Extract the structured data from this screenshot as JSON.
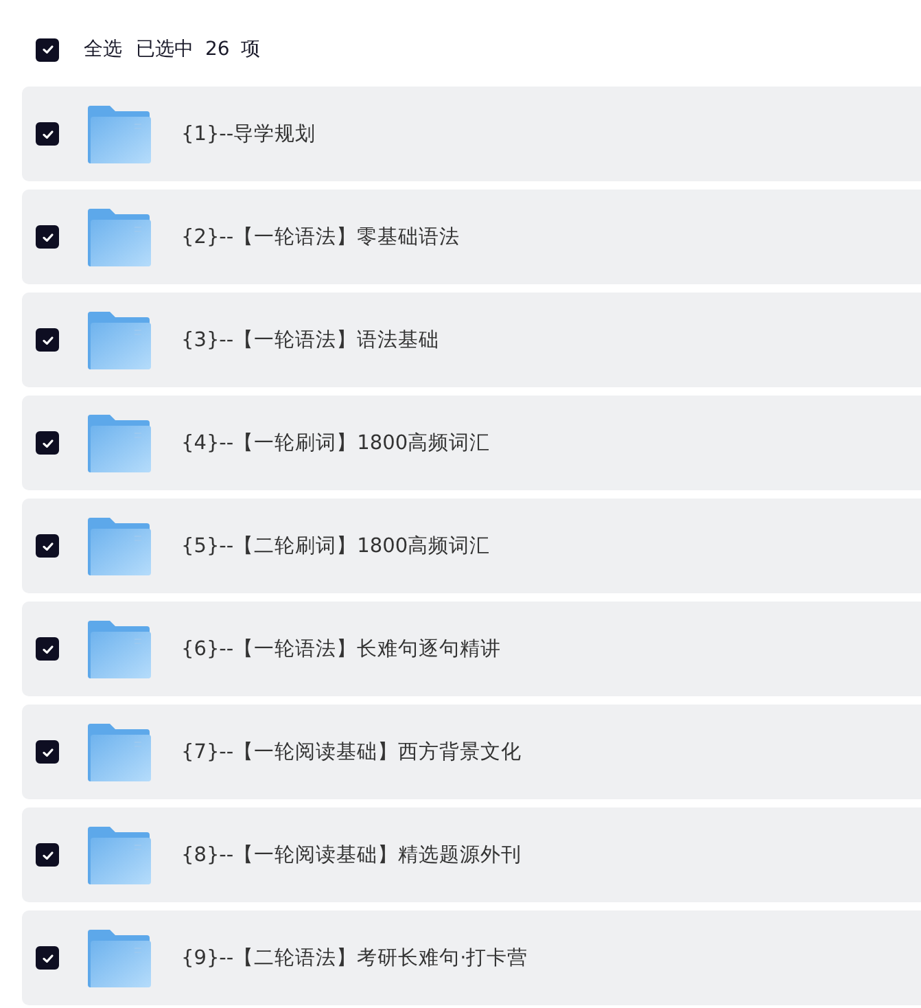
{
  "header": {
    "checked": true,
    "label": "全选",
    "status": "已选中 26 项"
  },
  "items": [
    {
      "name": "{1}--导学规划",
      "checked": true
    },
    {
      "name": "{2}--【一轮语法】零基础语法",
      "checked": true
    },
    {
      "name": "{3}--【一轮语法】语法基础",
      "checked": true
    },
    {
      "name": "{4}--【一轮刷词】1800高频词汇",
      "checked": true
    },
    {
      "name": "{5}--【二轮刷词】1800高频词汇",
      "checked": true
    },
    {
      "name": "{6}--【一轮语法】长难句逐句精讲",
      "checked": true
    },
    {
      "name": "{7}--【一轮阅读基础】西方背景文化",
      "checked": true
    },
    {
      "name": "{8}--【一轮阅读基础】精选题源外刊",
      "checked": true
    },
    {
      "name": "{9}--【二轮语法】考研长难句·打卡营",
      "checked": true
    }
  ]
}
